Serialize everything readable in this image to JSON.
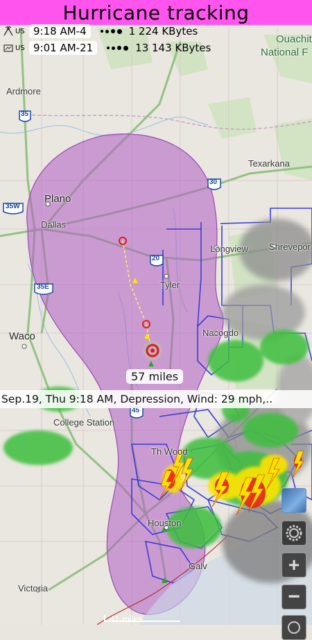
{
  "app": {
    "title": "Hurricane tracking"
  },
  "status": [
    {
      "region": "US",
      "time": "9:18 AM-4",
      "size": "1 224 KBytes",
      "icon": "signal-icon"
    },
    {
      "region": "US",
      "time": "9:01 AM-21",
      "size": "13 143 KBytes",
      "icon": "signal-icon"
    }
  ],
  "cities": {
    "ouachita": "Ouachita",
    "national_f": "National F",
    "ardmore": "Ardmore",
    "texarkana": "Texarkana",
    "plano": "Plano",
    "dallas": "Dallas",
    "longview": "Longview",
    "shreveport": "Shrevepor",
    "tyler": "Tyler",
    "nacogdoches": "Nacogdo",
    "waco": "Waco",
    "college_station": "College Station",
    "woodlands": "Th Wood",
    "houston": "Houston",
    "victoria": "Victoria",
    "galveston": "Galv"
  },
  "highways": {
    "i35": "35",
    "i30": "30",
    "i35w": "35W",
    "i35e": "35E",
    "i20": "20",
    "i45": "45"
  },
  "track": {
    "distance_label": "57 miles",
    "info": "Sep.19, Thu 9:18 AM, Depression, Wind: 29 mph,..",
    "scale_label": "41 miles"
  },
  "controls": {
    "layers": "layers-icon",
    "settings": "gear-icon",
    "zoom_in": "+",
    "zoom_out": "−",
    "locate": "locate-icon"
  },
  "colors": {
    "banner": "#ff55ee",
    "cone": "#b05cc4",
    "warning_lines": "#3b3bd6",
    "radar_green": "#3cbf3c",
    "radar_yellow": "#ffe400",
    "radar_red": "#e8221b"
  }
}
